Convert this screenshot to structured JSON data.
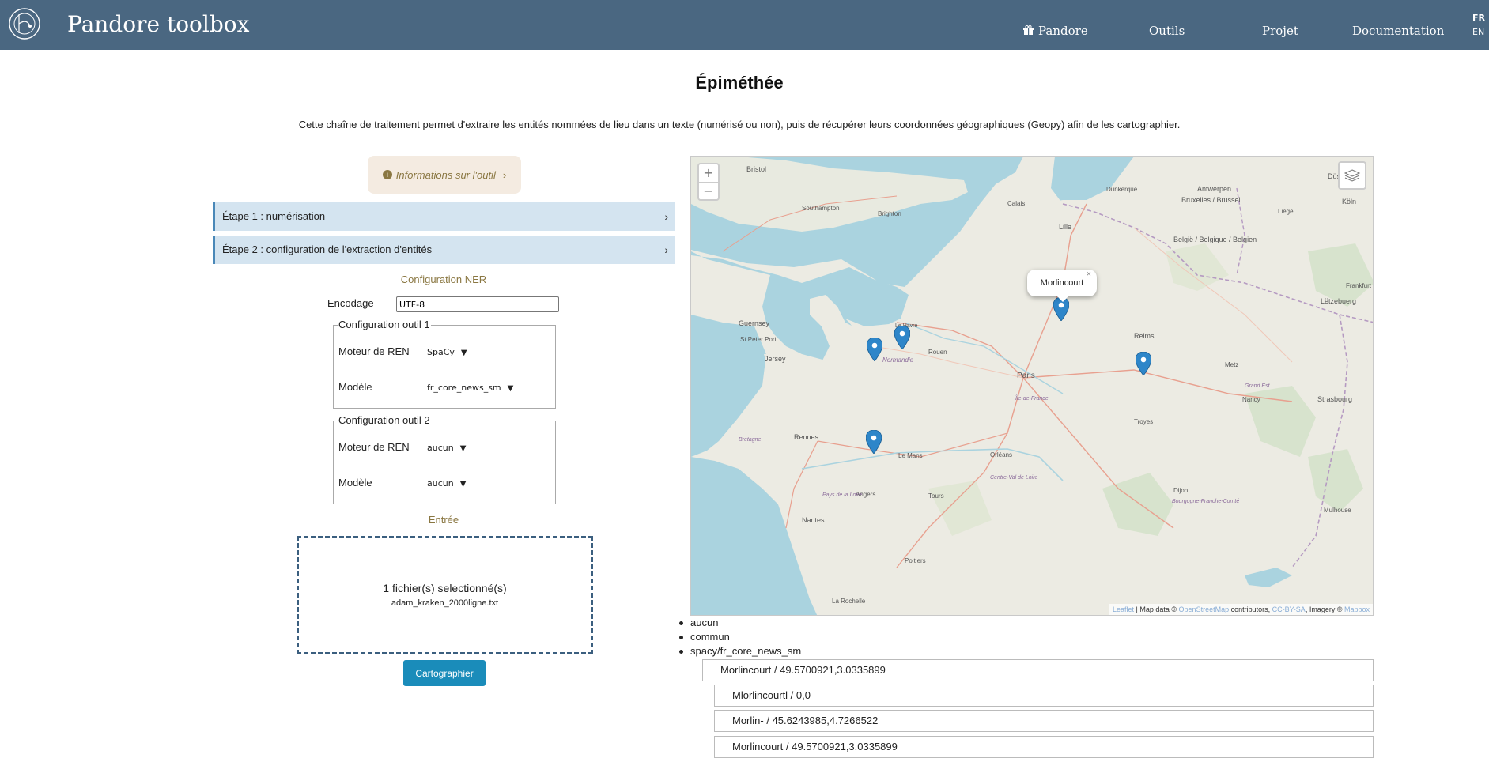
{
  "header": {
    "brand": "Pandore toolbox",
    "nav": {
      "pandore": "Pandore",
      "outils": "Outils",
      "projet": "Projet",
      "documentation": "Documentation"
    },
    "lang": {
      "fr": "FR",
      "en": "EN"
    },
    "colors": {
      "bar": "#4a6781"
    }
  },
  "page": {
    "title": "Épiméthée",
    "description": "Cette chaîne de traitement permet d'extraire les entités nommées de lieu dans un texte (numérisé ou non), puis de récupérer leurs coordonnées géographiques (Geopy) afin de les cartographier."
  },
  "left": {
    "info_button": "Informations sur l'outil",
    "step1": "Étape 1 : numérisation",
    "step2": "Étape 2 : configuration de l'extraction d'entités",
    "ner_title": "Configuration NER",
    "encoding_label": "Encodage",
    "encoding_value": "UTF-8",
    "tool1": {
      "legend": "Configuration outil 1",
      "engine_label": "Moteur de REN",
      "engine_value": "SpaCy",
      "model_label": "Modèle",
      "model_value": "fr_core_news_sm"
    },
    "tool2": {
      "legend": "Configuration outil 2",
      "engine_label": "Moteur de REN",
      "engine_value": "aucun",
      "model_label": "Modèle",
      "model_value": "aucun"
    },
    "input_title": "Entrée",
    "dropzone": {
      "count": "1 fichier(s) selectionné(s)",
      "filename": "adam_kraken_2000ligne.txt"
    },
    "map_button": "Cartographier"
  },
  "map": {
    "zoom_in": "+",
    "zoom_out": "−",
    "popup": "Morlincourt",
    "popup_close": "×",
    "attribution": {
      "leaflet": "Leaflet",
      "sep1": " | Map data © ",
      "osm": "OpenStreetMap",
      "contrib": " contributors, ",
      "license": "CC-BY-SA",
      "imagery": ", Imagery © ",
      "mapbox": "Mapbox"
    },
    "labels": {
      "bristol": "Bristol",
      "southampton": "Southampton",
      "brighton": "Brighton",
      "dunkerque": "Dunkerque",
      "lille": "Lille",
      "bruxelles": "Bruxelles / Brussel",
      "belgique": "België / Belgique / Belgien",
      "letzebuerg": "Lëtzebuerg",
      "guernsey": "Guernsey",
      "stpeter": "St Peter Port",
      "jersey": "Jersey",
      "lehavre": "Le Havre",
      "normandie": "Normandie",
      "paris": "Paris",
      "iledefrance": "Île-de-France",
      "rennes": "Rennes",
      "bretagne": "Bretagne",
      "lemans": "Le Mans",
      "angers": "Angers",
      "nantes": "Nantes",
      "orleans": "Orléans",
      "tours": "Tours",
      "troyes": "Troyes",
      "metz": "Metz",
      "nancy": "Nancy",
      "strasbourg": "Strasbourg",
      "grandest": "Grand Est",
      "larochelle": "La Rochelle",
      "poitiers": "Poitiers",
      "centre": "Centre-Val de Loire",
      "paysdelaloire": "Pays de la Loire",
      "bourgogne": "Bourgogne-Franche-Comté",
      "antwerpen": "Antwerpen",
      "dusseldorf": "Düsseldorf",
      "koln": "Köln",
      "frankfurt": "Frankfurt am Main",
      "mulhouse": "Mulhouse",
      "calais": "Calais",
      "liege": "Liège",
      "dijon": "Dijon",
      "rouen": "Rouen",
      "reims": "Reims"
    },
    "colors": {
      "sea": "#aad3df",
      "land": "#ecebe3",
      "marker": "#2e86c9"
    }
  },
  "results": {
    "list": [
      "aucun",
      "commun",
      "spacy/fr_core_news_sm"
    ],
    "items": [
      "Morlincourt / 49.5700921,3.0335899",
      "Mlorlincourtl / 0,0",
      "Morlin- / 45.6243985,4.7266522",
      "Morlincourt / 49.5700921,3.0335899"
    ]
  }
}
